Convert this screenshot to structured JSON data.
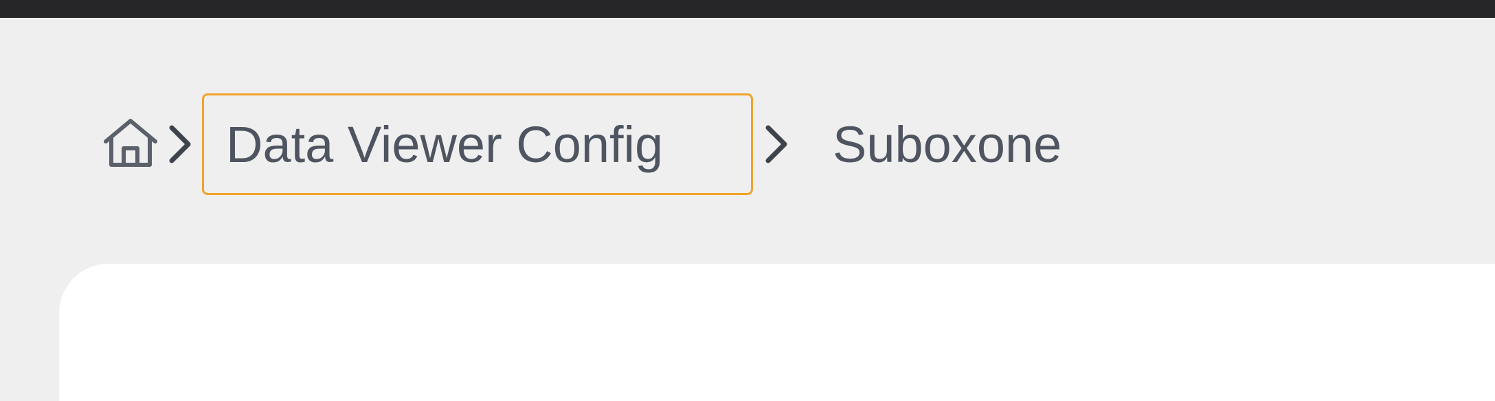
{
  "window": {
    "top_bar_color": "#262628"
  },
  "breadcrumb": {
    "home_icon": "home-icon",
    "separator_icon": "chevron-right-icon",
    "items": [
      {
        "label": "Data Viewer Config"
      },
      {
        "label": "Suboxone"
      }
    ],
    "focus_color": "#f2a22a"
  }
}
